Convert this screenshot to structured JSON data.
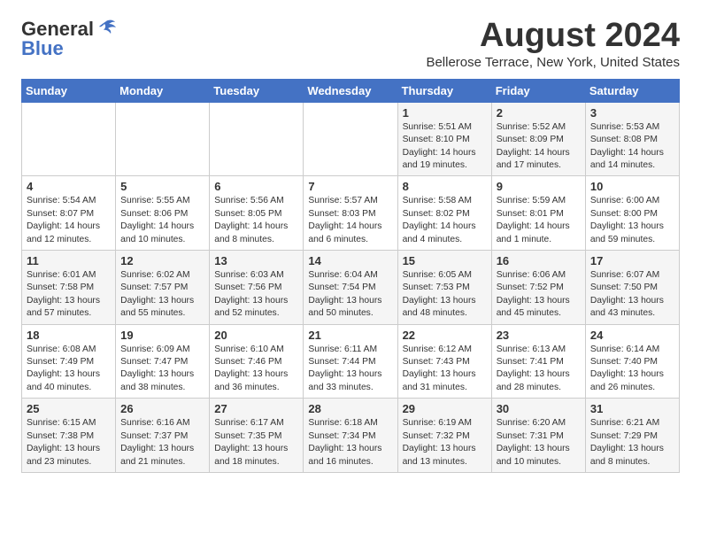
{
  "logo": {
    "line1": "General",
    "line2": "Blue"
  },
  "title": "August 2024",
  "subtitle": "Bellerose Terrace, New York, United States",
  "days_header": [
    "Sunday",
    "Monday",
    "Tuesday",
    "Wednesday",
    "Thursday",
    "Friday",
    "Saturday"
  ],
  "weeks": [
    [
      {
        "day": "",
        "content": ""
      },
      {
        "day": "",
        "content": ""
      },
      {
        "day": "",
        "content": ""
      },
      {
        "day": "",
        "content": ""
      },
      {
        "day": "1",
        "content": "Sunrise: 5:51 AM\nSunset: 8:10 PM\nDaylight: 14 hours\nand 19 minutes."
      },
      {
        "day": "2",
        "content": "Sunrise: 5:52 AM\nSunset: 8:09 PM\nDaylight: 14 hours\nand 17 minutes."
      },
      {
        "day": "3",
        "content": "Sunrise: 5:53 AM\nSunset: 8:08 PM\nDaylight: 14 hours\nand 14 minutes."
      }
    ],
    [
      {
        "day": "4",
        "content": "Sunrise: 5:54 AM\nSunset: 8:07 PM\nDaylight: 14 hours\nand 12 minutes."
      },
      {
        "day": "5",
        "content": "Sunrise: 5:55 AM\nSunset: 8:06 PM\nDaylight: 14 hours\nand 10 minutes."
      },
      {
        "day": "6",
        "content": "Sunrise: 5:56 AM\nSunset: 8:05 PM\nDaylight: 14 hours\nand 8 minutes."
      },
      {
        "day": "7",
        "content": "Sunrise: 5:57 AM\nSunset: 8:03 PM\nDaylight: 14 hours\nand 6 minutes."
      },
      {
        "day": "8",
        "content": "Sunrise: 5:58 AM\nSunset: 8:02 PM\nDaylight: 14 hours\nand 4 minutes."
      },
      {
        "day": "9",
        "content": "Sunrise: 5:59 AM\nSunset: 8:01 PM\nDaylight: 14 hours\nand 1 minute."
      },
      {
        "day": "10",
        "content": "Sunrise: 6:00 AM\nSunset: 8:00 PM\nDaylight: 13 hours\nand 59 minutes."
      }
    ],
    [
      {
        "day": "11",
        "content": "Sunrise: 6:01 AM\nSunset: 7:58 PM\nDaylight: 13 hours\nand 57 minutes."
      },
      {
        "day": "12",
        "content": "Sunrise: 6:02 AM\nSunset: 7:57 PM\nDaylight: 13 hours\nand 55 minutes."
      },
      {
        "day": "13",
        "content": "Sunrise: 6:03 AM\nSunset: 7:56 PM\nDaylight: 13 hours\nand 52 minutes."
      },
      {
        "day": "14",
        "content": "Sunrise: 6:04 AM\nSunset: 7:54 PM\nDaylight: 13 hours\nand 50 minutes."
      },
      {
        "day": "15",
        "content": "Sunrise: 6:05 AM\nSunset: 7:53 PM\nDaylight: 13 hours\nand 48 minutes."
      },
      {
        "day": "16",
        "content": "Sunrise: 6:06 AM\nSunset: 7:52 PM\nDaylight: 13 hours\nand 45 minutes."
      },
      {
        "day": "17",
        "content": "Sunrise: 6:07 AM\nSunset: 7:50 PM\nDaylight: 13 hours\nand 43 minutes."
      }
    ],
    [
      {
        "day": "18",
        "content": "Sunrise: 6:08 AM\nSunset: 7:49 PM\nDaylight: 13 hours\nand 40 minutes."
      },
      {
        "day": "19",
        "content": "Sunrise: 6:09 AM\nSunset: 7:47 PM\nDaylight: 13 hours\nand 38 minutes."
      },
      {
        "day": "20",
        "content": "Sunrise: 6:10 AM\nSunset: 7:46 PM\nDaylight: 13 hours\nand 36 minutes."
      },
      {
        "day": "21",
        "content": "Sunrise: 6:11 AM\nSunset: 7:44 PM\nDaylight: 13 hours\nand 33 minutes."
      },
      {
        "day": "22",
        "content": "Sunrise: 6:12 AM\nSunset: 7:43 PM\nDaylight: 13 hours\nand 31 minutes."
      },
      {
        "day": "23",
        "content": "Sunrise: 6:13 AM\nSunset: 7:41 PM\nDaylight: 13 hours\nand 28 minutes."
      },
      {
        "day": "24",
        "content": "Sunrise: 6:14 AM\nSunset: 7:40 PM\nDaylight: 13 hours\nand 26 minutes."
      }
    ],
    [
      {
        "day": "25",
        "content": "Sunrise: 6:15 AM\nSunset: 7:38 PM\nDaylight: 13 hours\nand 23 minutes."
      },
      {
        "day": "26",
        "content": "Sunrise: 6:16 AM\nSunset: 7:37 PM\nDaylight: 13 hours\nand 21 minutes."
      },
      {
        "day": "27",
        "content": "Sunrise: 6:17 AM\nSunset: 7:35 PM\nDaylight: 13 hours\nand 18 minutes."
      },
      {
        "day": "28",
        "content": "Sunrise: 6:18 AM\nSunset: 7:34 PM\nDaylight: 13 hours\nand 16 minutes."
      },
      {
        "day": "29",
        "content": "Sunrise: 6:19 AM\nSunset: 7:32 PM\nDaylight: 13 hours\nand 13 minutes."
      },
      {
        "day": "30",
        "content": "Sunrise: 6:20 AM\nSunset: 7:31 PM\nDaylight: 13 hours\nand 10 minutes."
      },
      {
        "day": "31",
        "content": "Sunrise: 6:21 AM\nSunset: 7:29 PM\nDaylight: 13 hours\nand 8 minutes."
      }
    ]
  ]
}
